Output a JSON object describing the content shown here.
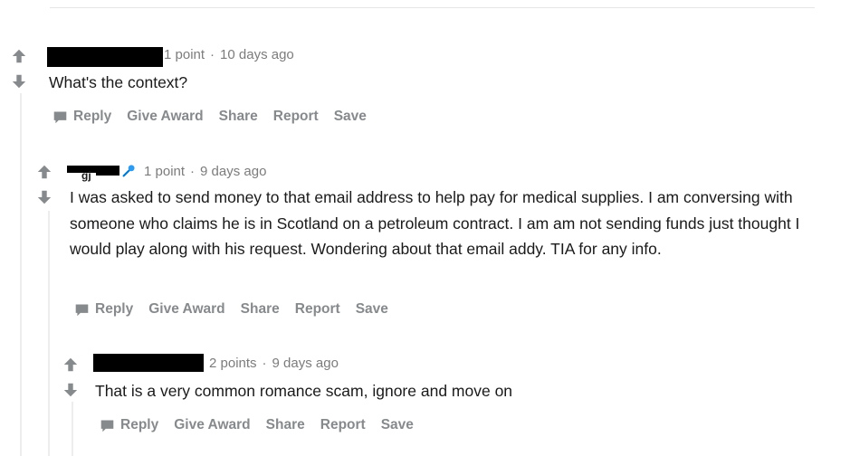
{
  "comments": [
    {
      "points": "1 point",
      "sep": "·",
      "time": "10 days ago",
      "text": "What's the context?",
      "actions": [
        "Reply",
        "Give Award",
        "Share",
        "Report",
        "Save"
      ]
    },
    {
      "username_partial": "gj",
      "points": "1 point",
      "sep": "·",
      "time": "9 days ago",
      "text": "I was asked to send money to that email address to help pay for medical supplies. I am conversing with someone who claims he is in Scotland on a petroleum contract. I am am not sending funds just thought I would play along with his request. Wondering about that email addy. TIA for any info.",
      "actions": [
        "Reply",
        "Give Award",
        "Share",
        "Report",
        "Save"
      ]
    },
    {
      "points": "2 points",
      "sep": "·",
      "time": "9 days ago",
      "text": "That is a very common romance scam, ignore and move on",
      "actions": [
        "Reply",
        "Give Award",
        "Share",
        "Report",
        "Save"
      ]
    }
  ],
  "icons": {
    "upvote": "arrow-up-icon",
    "downvote": "arrow-down-icon",
    "reply": "speech-bubble-icon",
    "flair": "microphone-icon"
  },
  "colors": {
    "muted": "#878a8c",
    "text": "#1a1a1b",
    "flair": "#0079d3"
  }
}
